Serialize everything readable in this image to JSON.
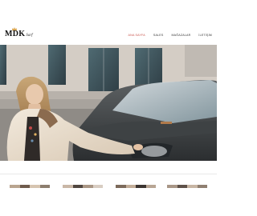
{
  "brand": {
    "logo_text": "MDK",
    "logo_sub": "Sarf",
    "crown_color": "#d7a24b"
  },
  "nav": {
    "items": [
      {
        "label": "ANA SAYFA",
        "active": true
      },
      {
        "label": "SALES",
        "active": false
      },
      {
        "label": "MAĞAZALAR",
        "active": false
      },
      {
        "label": "İLETİŞİM",
        "active": false
      }
    ],
    "active_color": "#c8524a"
  },
  "hero": {
    "image": "model-in-fur-coat-beside-car"
  },
  "thumbnails": [
    {
      "image": "product-thumbnail-1"
    },
    {
      "image": "product-thumbnail-2"
    },
    {
      "image": "product-thumbnail-3"
    },
    {
      "image": "product-thumbnail-4"
    }
  ]
}
